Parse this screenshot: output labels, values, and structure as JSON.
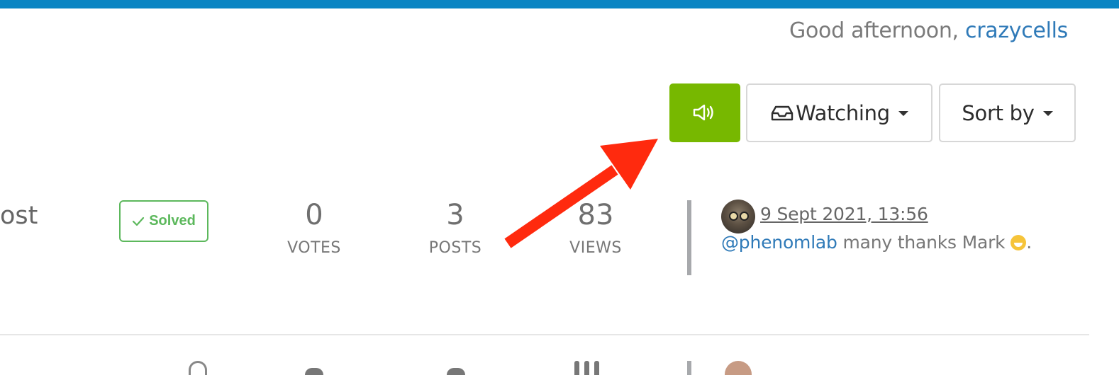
{
  "header": {
    "greeting_prefix": "Good afternoon, ",
    "username": "crazycells",
    "accent_color": "#0a85c3"
  },
  "toolbar": {
    "notify_icon": "megaphone-icon",
    "notify_color": "#77b800",
    "watch_icon": "inbox-icon",
    "watch_label": "Watching",
    "sort_label": "Sort by"
  },
  "topic": {
    "title_fragment": "ost",
    "badge": "Solved",
    "stats": {
      "votes_value": "0",
      "votes_label": "VOTES",
      "posts_value": "3",
      "posts_label": "POSTS",
      "views_value": "83",
      "views_label": "VIEWS"
    },
    "last_post": {
      "timestamp": "9 Sept 2021, 13:56",
      "mention": "@phenomlab",
      "message": " many thanks Mark ",
      "emoji": "grinning-face",
      "trailing": "."
    }
  },
  "annotation": {
    "arrow_color": "#ff2a0e"
  }
}
